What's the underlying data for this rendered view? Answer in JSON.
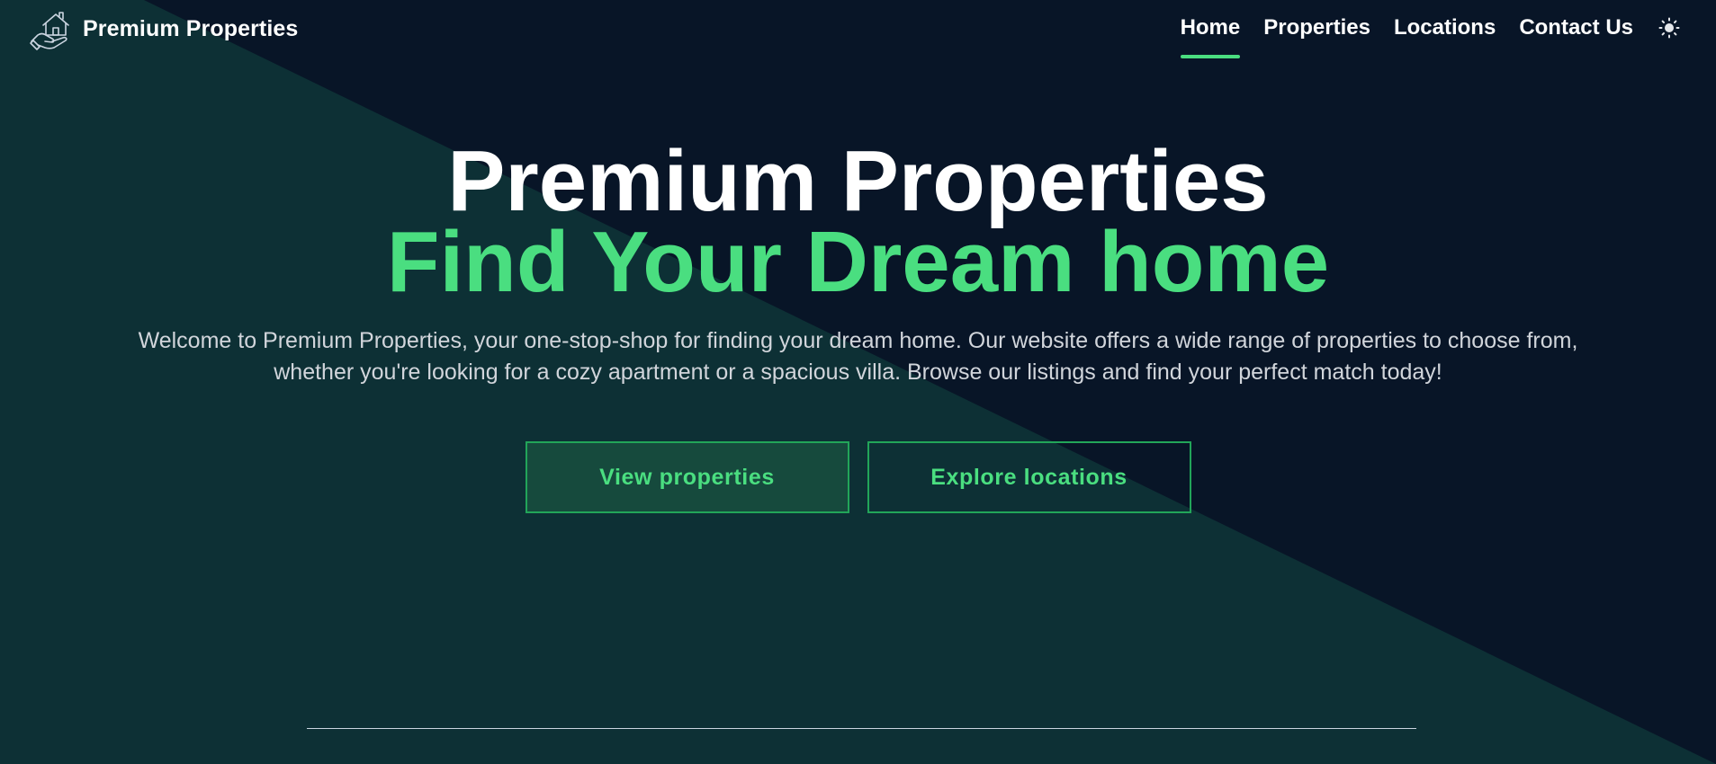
{
  "brand": {
    "name": "Premium Properties",
    "logo_icon": "house-in-hand-icon"
  },
  "nav": {
    "items": [
      {
        "label": "Home",
        "active": true
      },
      {
        "label": "Properties",
        "active": false
      },
      {
        "label": "Locations",
        "active": false
      },
      {
        "label": "Contact Us",
        "active": false
      }
    ],
    "theme_toggle_icon": "sun-icon"
  },
  "hero": {
    "title": "Premium Properties",
    "subtitle": "Find Your Dream home",
    "description": "Welcome to Premium Properties, your one-stop-shop for finding your dream home. Our website offers a wide range of properties to choose from, whether you're looking for a cozy apartment or a spacious villa. Browse our listings and find your perfect match today!",
    "primary_button": "View properties",
    "secondary_button": "Explore locations"
  },
  "colors": {
    "background_dark": "#081527",
    "background_teal": "#0d3035",
    "accent": "#4ade80",
    "button_border": "#22a559",
    "button_fill": "#164a3d"
  }
}
